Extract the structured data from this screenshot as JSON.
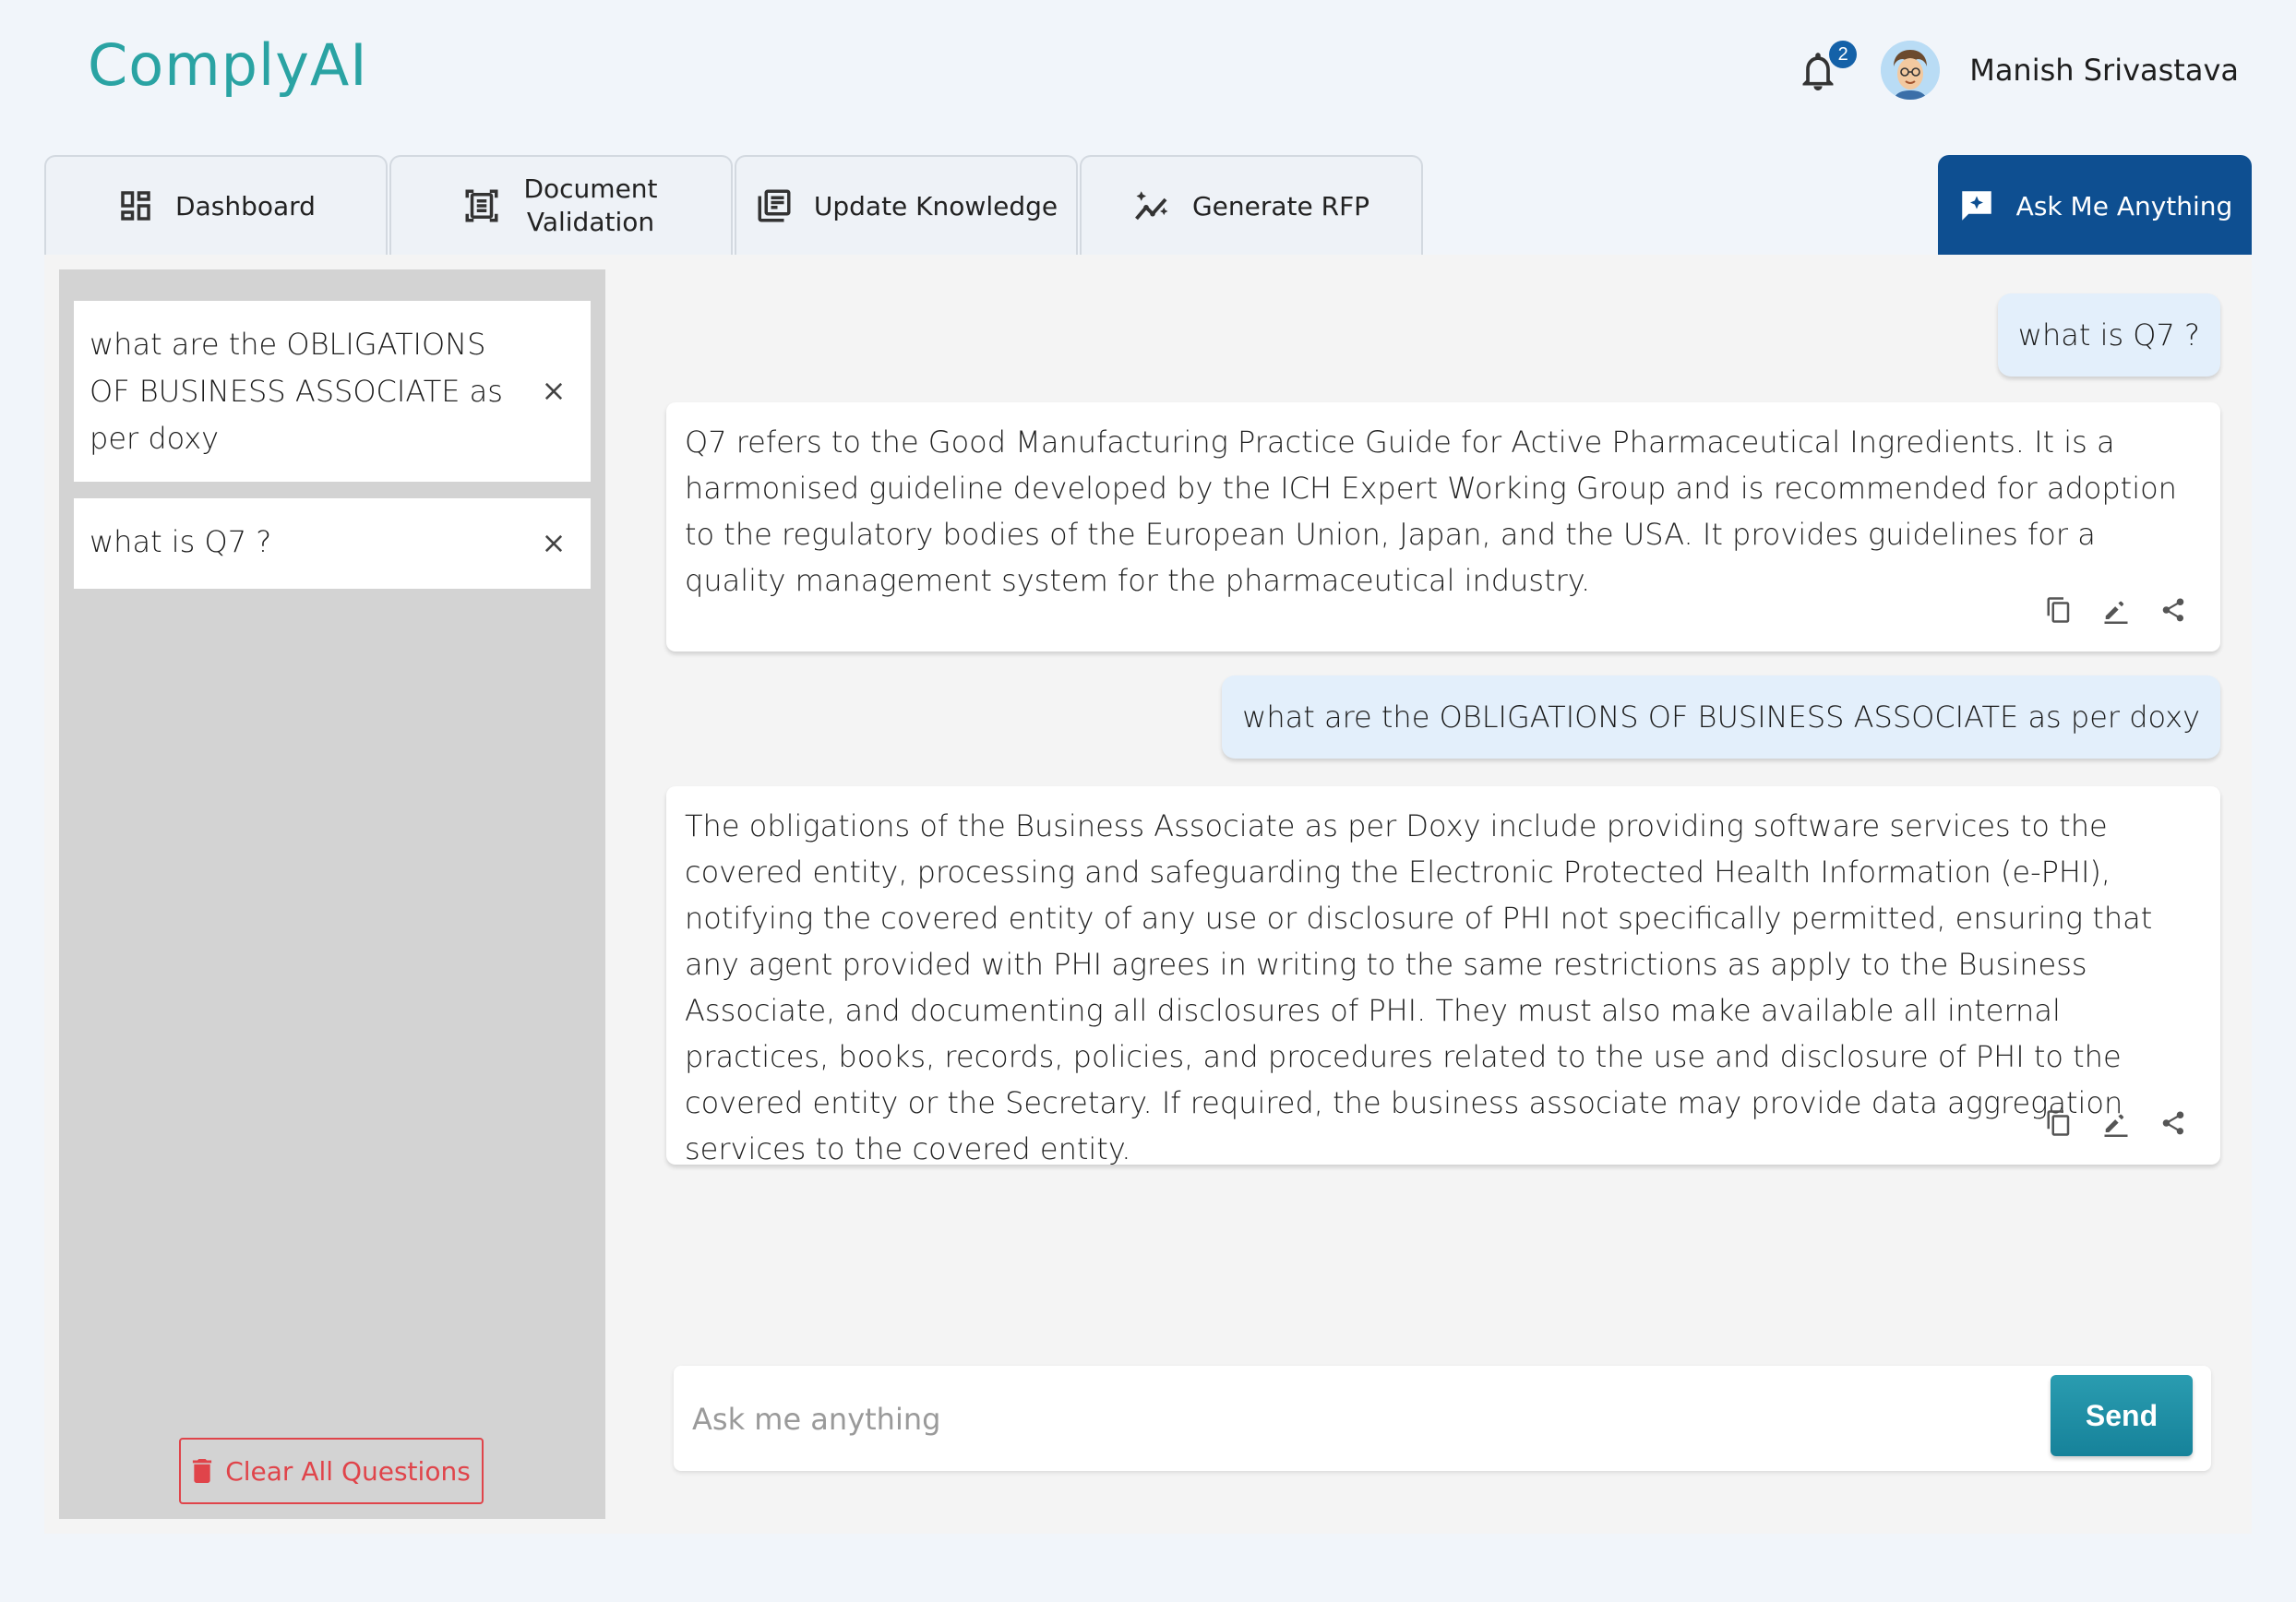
{
  "app": {
    "logo": "ComplyAI"
  },
  "header": {
    "notifications_count": "2",
    "user_name": "Manish Srivastava"
  },
  "tabs": [
    {
      "label": "Dashboard",
      "icon": "dashboard-icon",
      "active": false
    },
    {
      "label": "Document Validation",
      "icon": "document-scan-icon",
      "active": false
    },
    {
      "label": "Update Knowledge",
      "icon": "library-books-icon",
      "active": false
    },
    {
      "label": "Generate RFP",
      "icon": "sparkle-trend-icon",
      "active": false
    },
    {
      "label": "Ask Me Anything",
      "icon": "chat-sparkle-icon",
      "active": true
    }
  ],
  "sidebar": {
    "questions": [
      "what are the OBLIGATIONS OF BUSINESS ASSOCIATE as per doxy",
      "what is Q7 ?"
    ],
    "clear_label": "Clear All Questions"
  },
  "chat": {
    "messages": [
      {
        "role": "user",
        "text": "what is Q7 ?"
      },
      {
        "role": "assistant",
        "text": "Q7 refers to the Good Manufacturing Practice Guide for Active Pharmaceutical Ingredients. It is a harmonised guideline developed by the ICH Expert Working Group and is recommended for adoption to the regulatory bodies of the European Union, Japan, and the USA. It provides guidelines for a quality management system for the pharmaceutical industry."
      },
      {
        "role": "user",
        "text": "what are the OBLIGATIONS OF BUSINESS ASSOCIATE as per doxy"
      },
      {
        "role": "assistant",
        "text": "The obligations of the Business Associate as per Doxy include providing software services to the covered entity, processing and safeguarding the Electronic Protected Health Information (e-PHI), notifying the covered entity of any use or disclosure of PHI not specifically permitted, ensuring that any agent provided with PHI agrees in writing to the same restrictions as apply to the Business Associate, and documenting all disclosures of PHI. They must also make available all internal practices, books, records, policies, and procedures related to the use and disclosure of PHI to the covered entity or the Secretary. If required, the business associate may provide data aggregation services to the covered entity."
      }
    ],
    "input_placeholder": "Ask me anything",
    "input_value": "",
    "send_label": "Send"
  },
  "colors": {
    "brand_teal": "#2aa3a3",
    "active_tab": "#0e4f91",
    "danger": "#e0444a",
    "send_button": "#1a8aa2",
    "user_bubble": "#e3effb"
  }
}
